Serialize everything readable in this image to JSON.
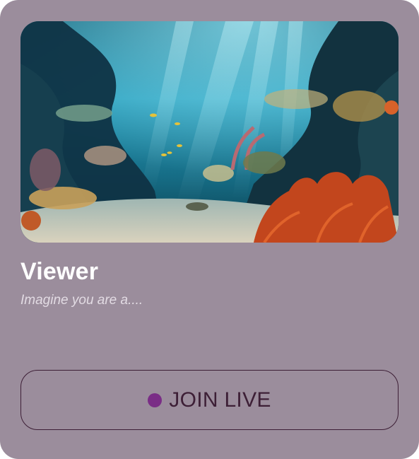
{
  "card": {
    "title": "Viewer",
    "subtitle": "Imagine you are a....",
    "image_description_icon": "underwater-coral-reef-image",
    "join_button": {
      "label": "JOIN LIVE",
      "indicator_color": "#7a2d86"
    }
  },
  "colors": {
    "card_background": "#9b8d9c",
    "title_text": "#ffffff",
    "subtitle_text": "#e2dbe3",
    "button_border": "#3d1f36",
    "button_text": "#3d1f36"
  }
}
